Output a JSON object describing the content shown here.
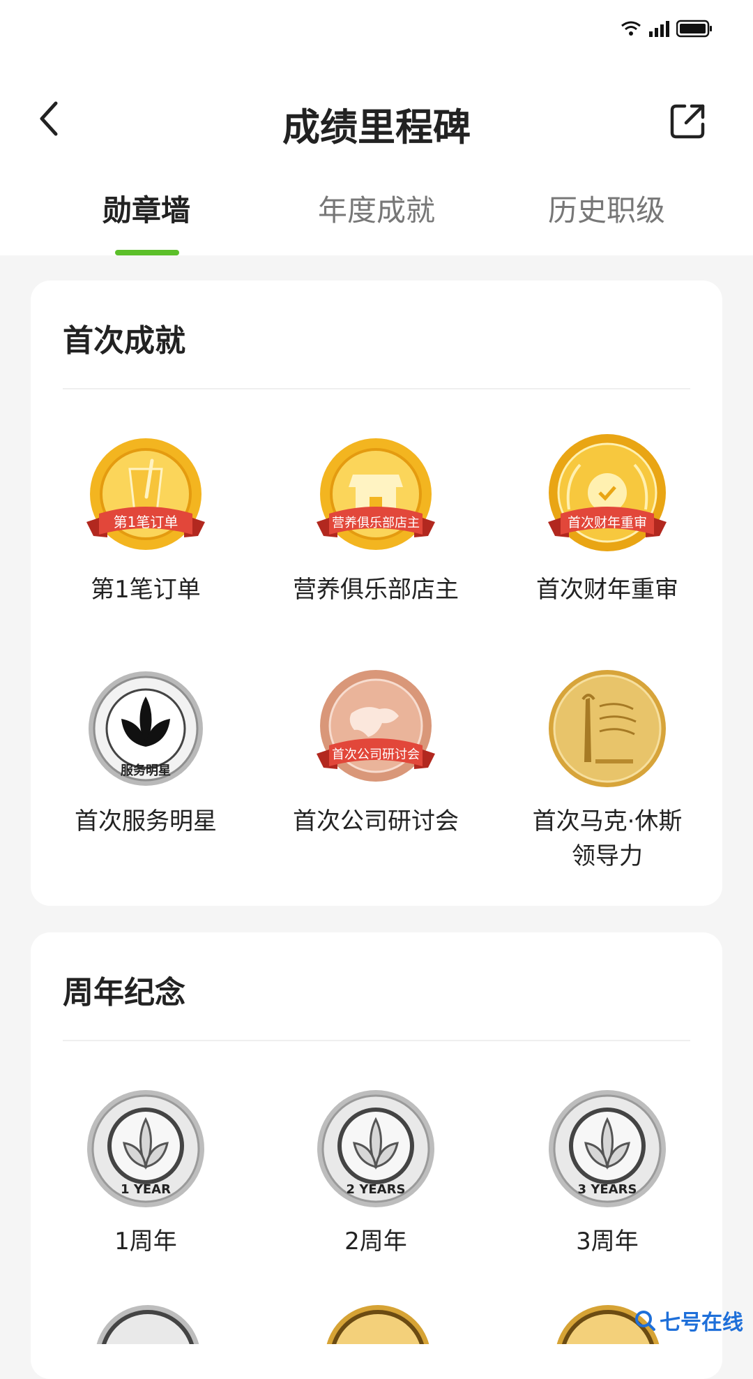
{
  "nav": {
    "title": "成绩里程碑"
  },
  "tabs": [
    {
      "label": "勋章墙",
      "active": true
    },
    {
      "label": "年度成就",
      "active": false
    },
    {
      "label": "历史职级",
      "active": false
    }
  ],
  "sections": [
    {
      "title": "首次成就",
      "badges": [
        {
          "label": "第1笔订单",
          "ribbon": "第1笔订单",
          "style": "gold-cup"
        },
        {
          "label": "营养俱乐部店主",
          "ribbon": "营养俱乐部店主",
          "style": "gold-shop"
        },
        {
          "label": "首次财年重审",
          "ribbon": "首次财年重审",
          "style": "gold-bag"
        },
        {
          "label": "首次服务明星",
          "ribbon": "服务明星",
          "style": "silver-leaf"
        },
        {
          "label": "首次公司研讨会",
          "ribbon": "首次公司研讨会",
          "style": "bronze-globe"
        },
        {
          "label_line1": "首次马克·休斯",
          "label_line2": "领导力",
          "style": "gold-coin"
        }
      ]
    },
    {
      "title": "周年纪念",
      "badges": [
        {
          "label": "1周年",
          "ring_text": "1 YEAR"
        },
        {
          "label": "2周年",
          "ring_text": "2 YEARS"
        },
        {
          "label": "3周年",
          "ring_text": "3 YEARS"
        }
      ]
    }
  ],
  "watermark": "七号在线",
  "colors": {
    "accent": "#5cbf2a",
    "ribbon": "#e2473a",
    "gold": "#f2b61c",
    "silver": "#c9c9c9",
    "bronze": "#d99779"
  }
}
